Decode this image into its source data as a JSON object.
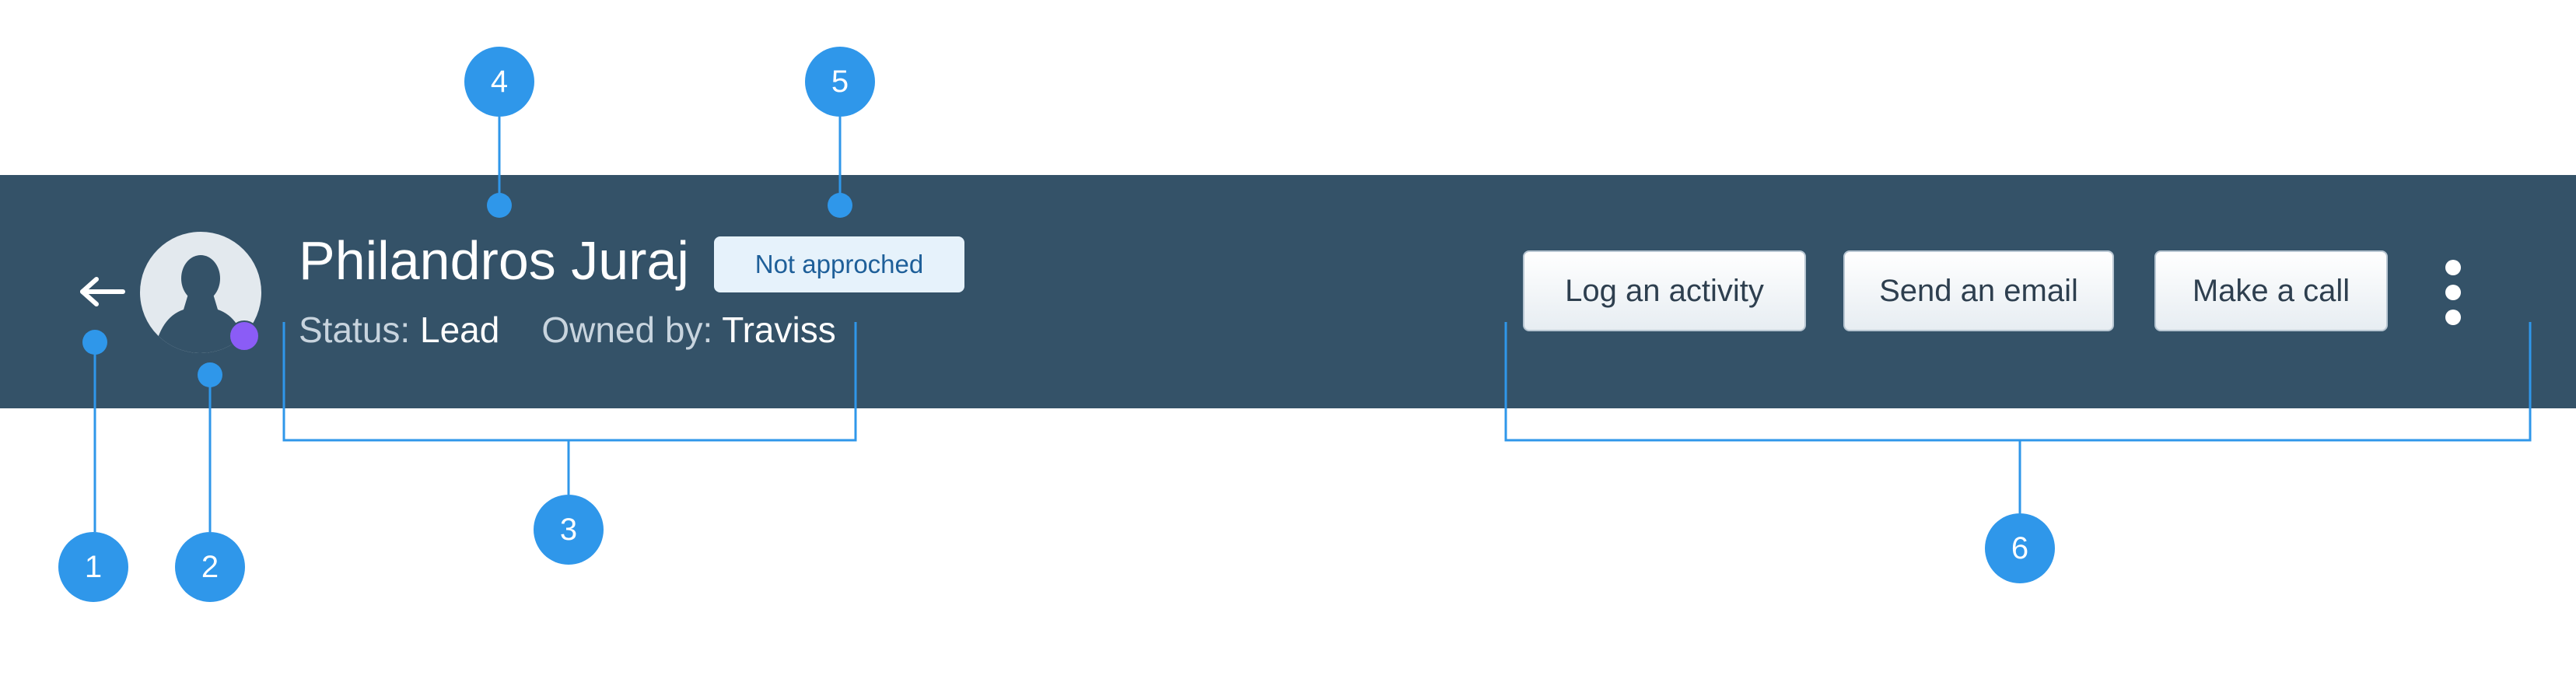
{
  "header": {
    "back_icon": "arrow-left-icon",
    "avatar_icon": "person-silhouette-icon",
    "presence_color": "#8b5cf6",
    "name": "Philandros Juraj",
    "badge": "Not approched",
    "status_label": "Status:",
    "status_value": "Lead",
    "owner_label": "Owned by:",
    "owner_value": "Traviss",
    "background_color": "#345268"
  },
  "actions": {
    "log_activity": "Log an activity",
    "send_email": "Send an email",
    "make_call": "Make a call",
    "more_icon": "kebab-menu-icon"
  },
  "annotations": {
    "accent_color": "#2f97ea",
    "markers": [
      "1",
      "2",
      "3",
      "4",
      "5",
      "6"
    ]
  }
}
